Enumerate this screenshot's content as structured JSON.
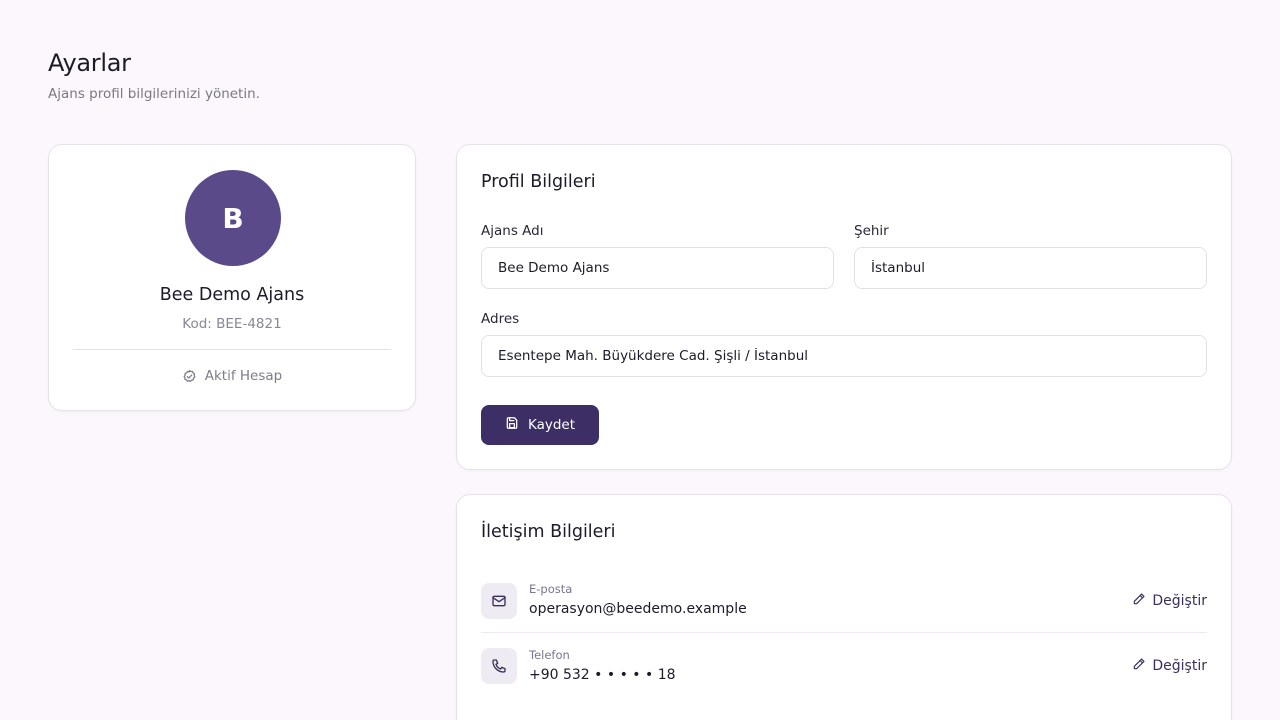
{
  "header": {
    "title": "Ayarlar",
    "subtitle": "Ajans profil bilgilerinizi yönetin."
  },
  "profile": {
    "avatar_initial": "B",
    "name": "Bee Demo Ajans",
    "code": "Kod: BEE-4821",
    "status": "Aktif Hesap",
    "avatar_color": "#5a4a8a"
  },
  "profile_form": {
    "title": "Profil Bilgileri",
    "agency_name_label": "Ajans Adı",
    "agency_name_value": "Bee Demo Ajans",
    "city_label": "Şehir",
    "city_value": "İstanbul",
    "address_label": "Adres",
    "address_value": "Esentepe Mah. Büyükdere Cad. Şişli / İstanbul",
    "save_label": "Kaydet",
    "save_color": "#3d2f66"
  },
  "contact": {
    "title": "İletişim Bilgileri",
    "email_label": "E-posta",
    "email_value": "operasyon@beedemo.example",
    "phone_label": "Telefon",
    "phone_value": "+90 532 • • • • • 18",
    "change_label": "Değiştir"
  },
  "icons": {
    "status": "check-circle-icon",
    "save": "save-icon",
    "email": "mail-icon",
    "phone": "phone-icon",
    "edit": "pencil-icon"
  }
}
